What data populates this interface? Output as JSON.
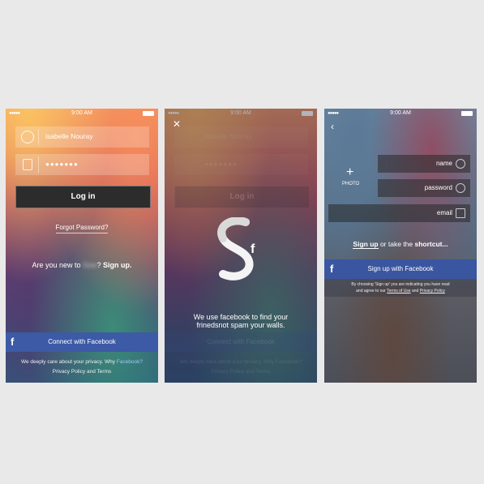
{
  "status": {
    "carrier_dots": "●●●●●",
    "time": "9:00 AM"
  },
  "screen1": {
    "username_value": "isabelle Nouray",
    "password_mask": "●●●●●●●",
    "login_label": "Log in",
    "forgot_label": "Forgot Password?",
    "new_prefix": "Are you new to ",
    "new_blurred": "Sow",
    "new_mid": "? ",
    "signup_label": "Sign up.",
    "facebook_icon": "f",
    "facebook_label": "Connect with Facebook",
    "care_text": "We deeply care about your privacy. Why ",
    "care_link": "Facebook?",
    "policy_text": "Privacy Policy and Terms"
  },
  "screen2": {
    "close_icon": "✕",
    "username_value": "isabelle Nouray",
    "password_mask": "●●●●●●●",
    "login_label": "Log in",
    "logo_letter": "f",
    "message_line1": "We use facebook to find your",
    "message_line2": "frinedsnot spam your walls.",
    "facebook_label": "Connect with Facebook",
    "care_text": "We deeply care about your privacy. Why Facebook?",
    "policy_text": "Privacy Policy and Terms"
  },
  "screen3": {
    "back_icon": "‹",
    "plus_icon": "+",
    "photo_label": "PHOTO",
    "name_label": "name",
    "password_label": "password",
    "email_label": "email",
    "signup_link": "Sign up",
    "shortcut_mid": " or take the ",
    "shortcut_label": "shortcut...",
    "facebook_icon": "f",
    "facebook_label": "Sign up with Facebook",
    "terms_line1": "By choosing 'Sign up' you are indicating you have read",
    "terms_line2_prefix": "and agree to our ",
    "terms_link": "Terms of Use",
    "terms_and": " and ",
    "privacy_link": "Privacy Policy"
  },
  "colors": {
    "facebook_blue": "#3c5aa5",
    "background": "#e9e9e9"
  }
}
